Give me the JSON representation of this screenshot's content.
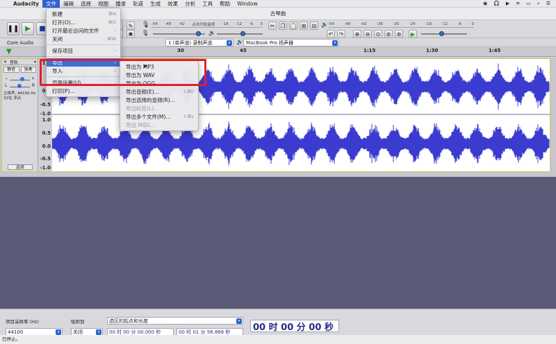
{
  "menubar": {
    "app": "Audacity",
    "items": [
      "文件",
      "编辑",
      "选择",
      "视图",
      "播录",
      "轨道",
      "生成",
      "效果",
      "分析",
      "工具",
      "帮助",
      "Window"
    ],
    "active_index": 0
  },
  "window": {
    "title": "古琴曲"
  },
  "meters": {
    "record_scale": [
      "-54",
      "-48",
      "-42",
      "-18",
      "-12",
      "-6",
      "0"
    ],
    "record_hint": "点击开始监视",
    "play_scale": [
      "-54",
      "-48",
      "-42",
      "-36",
      "-30",
      "-24",
      "-18",
      "-12",
      "-6",
      "0"
    ]
  },
  "devices": {
    "host": "Core Audio",
    "channels": "1 (单声道) 录制声道",
    "output": "MacBook Pro 扬声器"
  },
  "ruler": {
    "ticks": [
      "30",
      "45",
      "1:15",
      "1:30",
      "1:45"
    ]
  },
  "track": {
    "name": "音轨",
    "mute": "静音",
    "solo": "独奏",
    "info": "立体声, 44100 Hz\n32位 浮点",
    "select": "选择",
    "scale": [
      "1.0",
      "0.0",
      "-0.5",
      "-1.0",
      "1.0",
      "0.5",
      "0.0",
      "-0.5",
      "-1.0"
    ]
  },
  "file_menu": {
    "items": [
      {
        "label": "新建",
        "shortcut": "⌘N"
      },
      {
        "label": "打开(O)...",
        "shortcut": "⌘O"
      },
      {
        "label": "打开最近访问的文件",
        "shortcut": "›"
      },
      {
        "label": "关闭",
        "shortcut": "⌘W"
      },
      {
        "label": "保存项目",
        "shortcut": "›"
      },
      {
        "label": "导出",
        "shortcut": "›"
      },
      {
        "label": "导入",
        "shortcut": "›"
      },
      {
        "label": "页面设置(U)...",
        "shortcut": ""
      },
      {
        "label": "打印(P)...",
        "shortcut": ""
      }
    ]
  },
  "export_menu": {
    "items": [
      {
        "label": "导出为 MP3",
        "shortcut": "",
        "disabled": false
      },
      {
        "label": "导出为 WAV",
        "shortcut": "",
        "disabled": false
      },
      {
        "label": "导出为 OGG",
        "shortcut": "",
        "disabled": false
      },
      {
        "label": "导出音频(E)...",
        "shortcut": "⇧⌘E",
        "disabled": false
      },
      {
        "label": "导出选择的音频(R)...",
        "shortcut": "",
        "disabled": false
      },
      {
        "label": "导出标签(L)...",
        "shortcut": "",
        "disabled": true
      },
      {
        "label": "导出多个文件(M)...",
        "shortcut": "⇧⌘L",
        "disabled": false
      },
      {
        "label": "导出 MIDI...",
        "shortcut": "",
        "disabled": true
      }
    ]
  },
  "bottom": {
    "rate_label": "项目采样率 (Hz)",
    "rate_value": "44100",
    "snap_label": "吸附到",
    "snap_value": "关闭",
    "sel_label": "选区的起点和长度",
    "start_time": "00 时 00 分 00.000 秒",
    "length_time": "00 时 01 分 56.866 秒",
    "big_time": "00 时 00 分 00 秒",
    "status": "已停止。"
  },
  "colors": {
    "wave": "#3b3bd0",
    "highlight": "#e01f2a",
    "menu_highlight": "#3a70d8"
  }
}
